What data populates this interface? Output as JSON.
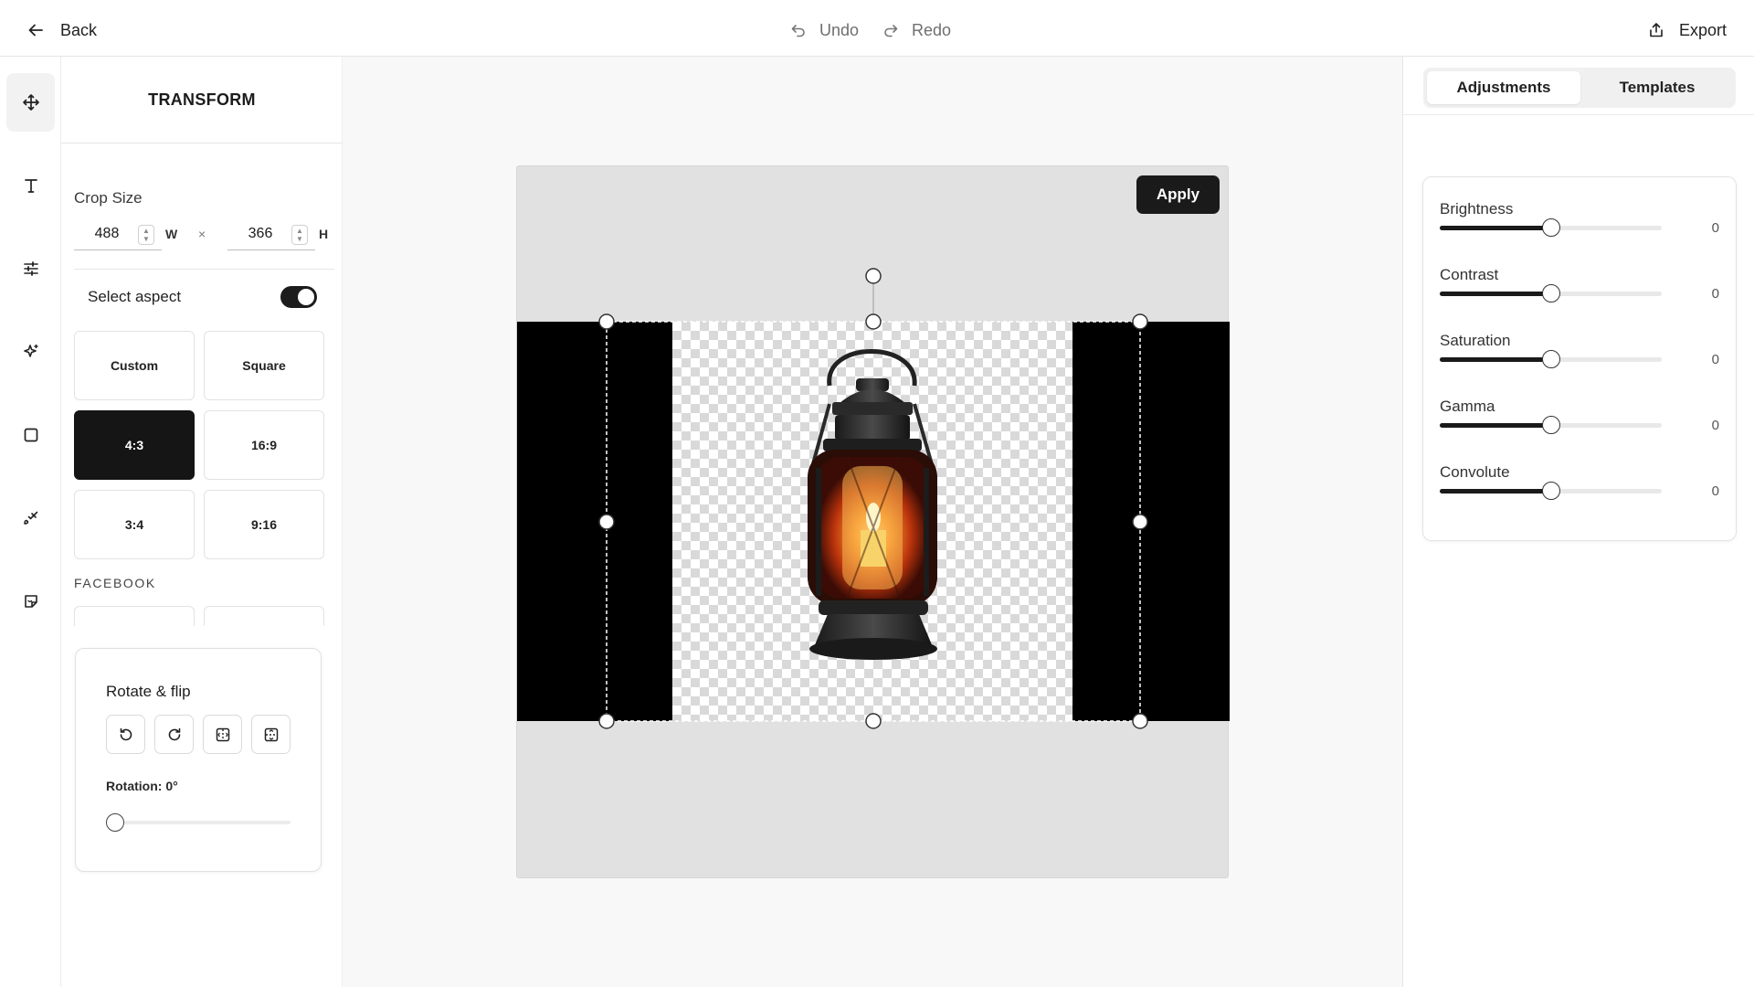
{
  "topbar": {
    "back_label": "Back",
    "undo_label": "Undo",
    "redo_label": "Redo",
    "export_label": "Export"
  },
  "rail": {
    "items": [
      {
        "name": "move-icon",
        "active": true
      },
      {
        "name": "text-icon",
        "active": false
      },
      {
        "name": "sliders-icon",
        "active": false
      },
      {
        "name": "sparkle-icon",
        "active": false
      },
      {
        "name": "square-icon",
        "active": false
      },
      {
        "name": "brush-icon",
        "active": false
      },
      {
        "name": "sticker-icon",
        "active": false
      }
    ]
  },
  "panel": {
    "title": "TRANSFORM",
    "crop_size_label": "Crop Size",
    "width_value": "488",
    "width_unit": "W",
    "times": "×",
    "height_value": "366",
    "height_unit": "H",
    "select_aspect_label": "Select aspect",
    "select_aspect_on": true,
    "presets": [
      {
        "label": "Custom",
        "selected": false
      },
      {
        "label": "Square",
        "selected": false
      },
      {
        "label": "4:3",
        "selected": true
      },
      {
        "label": "16:9",
        "selected": false
      },
      {
        "label": "3:4",
        "selected": false
      },
      {
        "label": "9:16",
        "selected": false
      }
    ],
    "facebook_label": "FACEBOOK",
    "rotate": {
      "title": "Rotate & flip",
      "buttons": [
        "rotate-left-icon",
        "rotate-right-icon",
        "flip-horizontal-icon",
        "flip-vertical-icon"
      ],
      "rotation_label": "Rotation: 0°",
      "rotation_value": 0
    }
  },
  "canvas": {
    "apply_label": "Apply"
  },
  "right_panel": {
    "tabs": [
      {
        "label": "Adjustments",
        "active": true
      },
      {
        "label": "Templates",
        "active": false
      }
    ],
    "adjustments": [
      {
        "label": "Brightness",
        "value": "0",
        "level": 0.5
      },
      {
        "label": "Contrast",
        "value": "0",
        "level": 0.5
      },
      {
        "label": "Saturation",
        "value": "0",
        "level": 0.5
      },
      {
        "label": "Gamma",
        "value": "0",
        "level": 0.5
      },
      {
        "label": "Convolute",
        "value": "0",
        "level": 0.5
      }
    ]
  },
  "colors": {
    "accent": "#1a1a1a",
    "canvas_bg": "#e1e1e1",
    "workspace_bg": "#f8f8f8"
  }
}
